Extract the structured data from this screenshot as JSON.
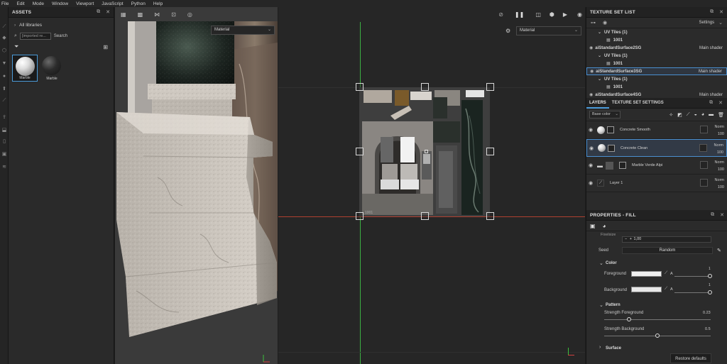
{
  "menu": [
    "File",
    "Edit",
    "Mode",
    "Window",
    "Viewport",
    "JavaScript",
    "Python",
    "Help"
  ],
  "assets": {
    "title": "ASSETS",
    "library": "All libraries",
    "search_value": "[imported re...",
    "search_label": "Search",
    "items": [
      {
        "label": "Marble",
        "color": "#dcdcdc"
      },
      {
        "label": "Marble",
        "color": "#2a2a2a"
      }
    ]
  },
  "viewport": {
    "material_3d": "Material",
    "material_2d": "Material",
    "uv_label": "1001"
  },
  "texture_set_list": {
    "title": "TEXTURE SET LIST",
    "settings_label": "Settings",
    "rows": [
      {
        "kind": "sub",
        "text": "UV Tiles (1)"
      },
      {
        "kind": "tile",
        "text": "1001"
      },
      {
        "kind": "shader",
        "text": "aiStandardSurface2SG",
        "shader": "Main shader",
        "selected": false
      },
      {
        "kind": "sub",
        "text": "UV Tiles (1)"
      },
      {
        "kind": "tile",
        "text": "1001"
      },
      {
        "kind": "shader",
        "text": "aiStandardSurface3SG",
        "shader": "Main shader",
        "selected": true
      },
      {
        "kind": "sub",
        "text": "UV Tiles (1)"
      },
      {
        "kind": "tile",
        "text": "1001"
      },
      {
        "kind": "shader",
        "text": "aiStandardSurface4SG",
        "shader": "Main shader",
        "selected": false
      },
      {
        "kind": "sub",
        "text": "UV Tiles (1)"
      }
    ]
  },
  "layers": {
    "tab_layers": "LAYERS",
    "tab_tss": "TEXTURE SET SETTINGS",
    "channel": "Base color",
    "items": [
      {
        "name": "Concrete Smooth",
        "blend": "Norm",
        "opacity": "100",
        "swatch": "#d8d8d8",
        "selected": false,
        "folder": false
      },
      {
        "name": "Concrete Clean",
        "blend": "Norm",
        "opacity": "100",
        "swatch": "#cfcfcf",
        "selected": true,
        "folder": false
      },
      {
        "name": "Marble Verde Alpi",
        "blend": "Norm",
        "opacity": "100",
        "swatch": "#555555",
        "selected": false,
        "folder": true
      },
      {
        "name": "Layer 1",
        "blend": "Norm",
        "opacity": "100",
        "swatch": "#3a3a3a",
        "selected": false,
        "folder": false
      }
    ]
  },
  "properties": {
    "title": "PROPERTIES - FILL",
    "cut_label": "Fixelsize",
    "stepper_value": "1,00",
    "seed_label": "Seed",
    "seed_value": "Random",
    "color_section": "Color",
    "foreground_label": "Foreground",
    "foreground_value": "1",
    "foreground_fill": 1,
    "background_label": "Background",
    "background_value": "1",
    "background_fill": 1,
    "channel_letter": "A",
    "pattern_section": "Pattern",
    "strength_fg_label": "Strength Foreground",
    "strength_fg_value": "0.23",
    "strength_fg_fill": 0.23,
    "strength_bg_label": "Strength Background",
    "strength_bg_value": "0.5",
    "strength_bg_fill": 0.5,
    "surface_section": "Surface",
    "restore_label": "Restore defaults"
  }
}
